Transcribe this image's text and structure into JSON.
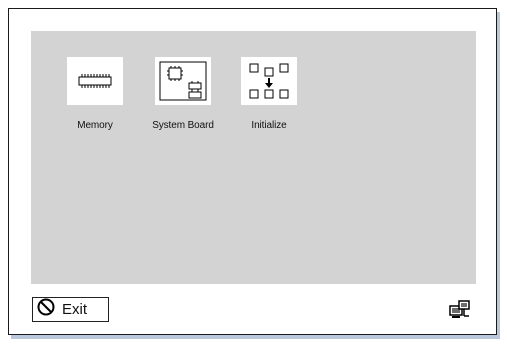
{
  "items": [
    {
      "label": "Memory",
      "icon": "memory-chip-icon"
    },
    {
      "label": "System Board",
      "icon": "system-board-icon"
    },
    {
      "label": "Initialize",
      "icon": "initialize-icon"
    }
  ],
  "exit": {
    "label": "Exit",
    "icon": "no-entry-icon"
  },
  "status_icon": "network-computer-icon",
  "colors": {
    "workspace": "#d3d3d3",
    "frame_border": "#1a1a1a",
    "shadow": "#b9c8da"
  }
}
